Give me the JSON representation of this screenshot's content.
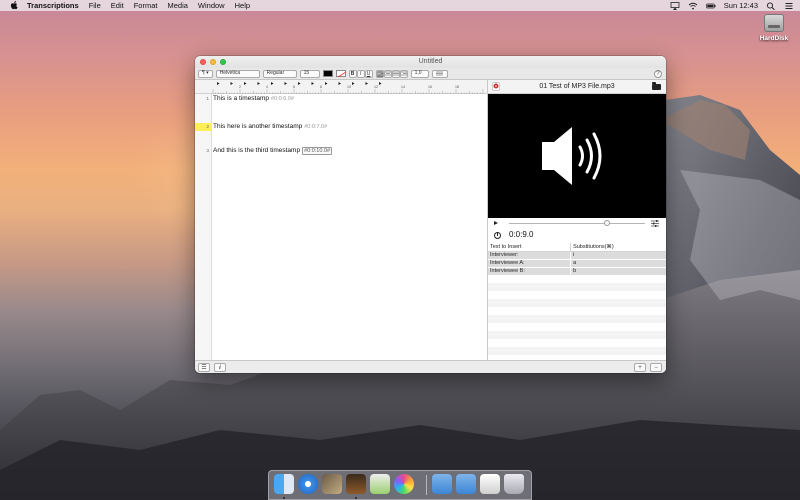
{
  "menubar": {
    "app_name": "Transcriptions",
    "items": [
      "File",
      "Edit",
      "Format",
      "Media",
      "Window",
      "Help"
    ],
    "clock": "Sun 12:43"
  },
  "desktop": {
    "drive_label": "HardDisk"
  },
  "window": {
    "title": "Untitled",
    "toolbar": {
      "paragraph_style": "¶",
      "font_family": "Helvetica",
      "font_style": "Regular",
      "font_size": "15",
      "bold": "B",
      "italic": "I",
      "underline": "U",
      "line_spacing": "1,0"
    },
    "ruler_numbers": [
      "2",
      "4",
      "6",
      "8",
      "10",
      "12",
      "14",
      "16",
      "18"
    ],
    "editor": {
      "lines": [
        {
          "number": "1",
          "text": "This is a timestamp",
          "timestamp": "#0:0:6.0#",
          "highlighted": false
        },
        {
          "number": "2",
          "text": "This here is another timestamp",
          "timestamp": "#0:0:7.0#",
          "highlighted": true
        },
        {
          "number": "3",
          "text": "And this is the third timestamp",
          "timestamp": "#0:0:10.0#",
          "highlighted": false
        }
      ]
    },
    "media_panel": {
      "filename": "01 Test of MP3 File.mp3",
      "time": "0:0:9.0",
      "progress_fraction": 0.72
    },
    "substitutions": {
      "headers": [
        "Text to Insert",
        "Substitutions(⌘)"
      ],
      "rows": [
        {
          "text": "Interviewer:",
          "key": "i"
        },
        {
          "text": "Interviewee A:",
          "key": "a"
        },
        {
          "text": "Interviewee B:",
          "key": "b"
        }
      ]
    },
    "bottom": {
      "list_label": "☰",
      "info_label": "i",
      "add_label": "+",
      "remove_label": "−"
    }
  }
}
